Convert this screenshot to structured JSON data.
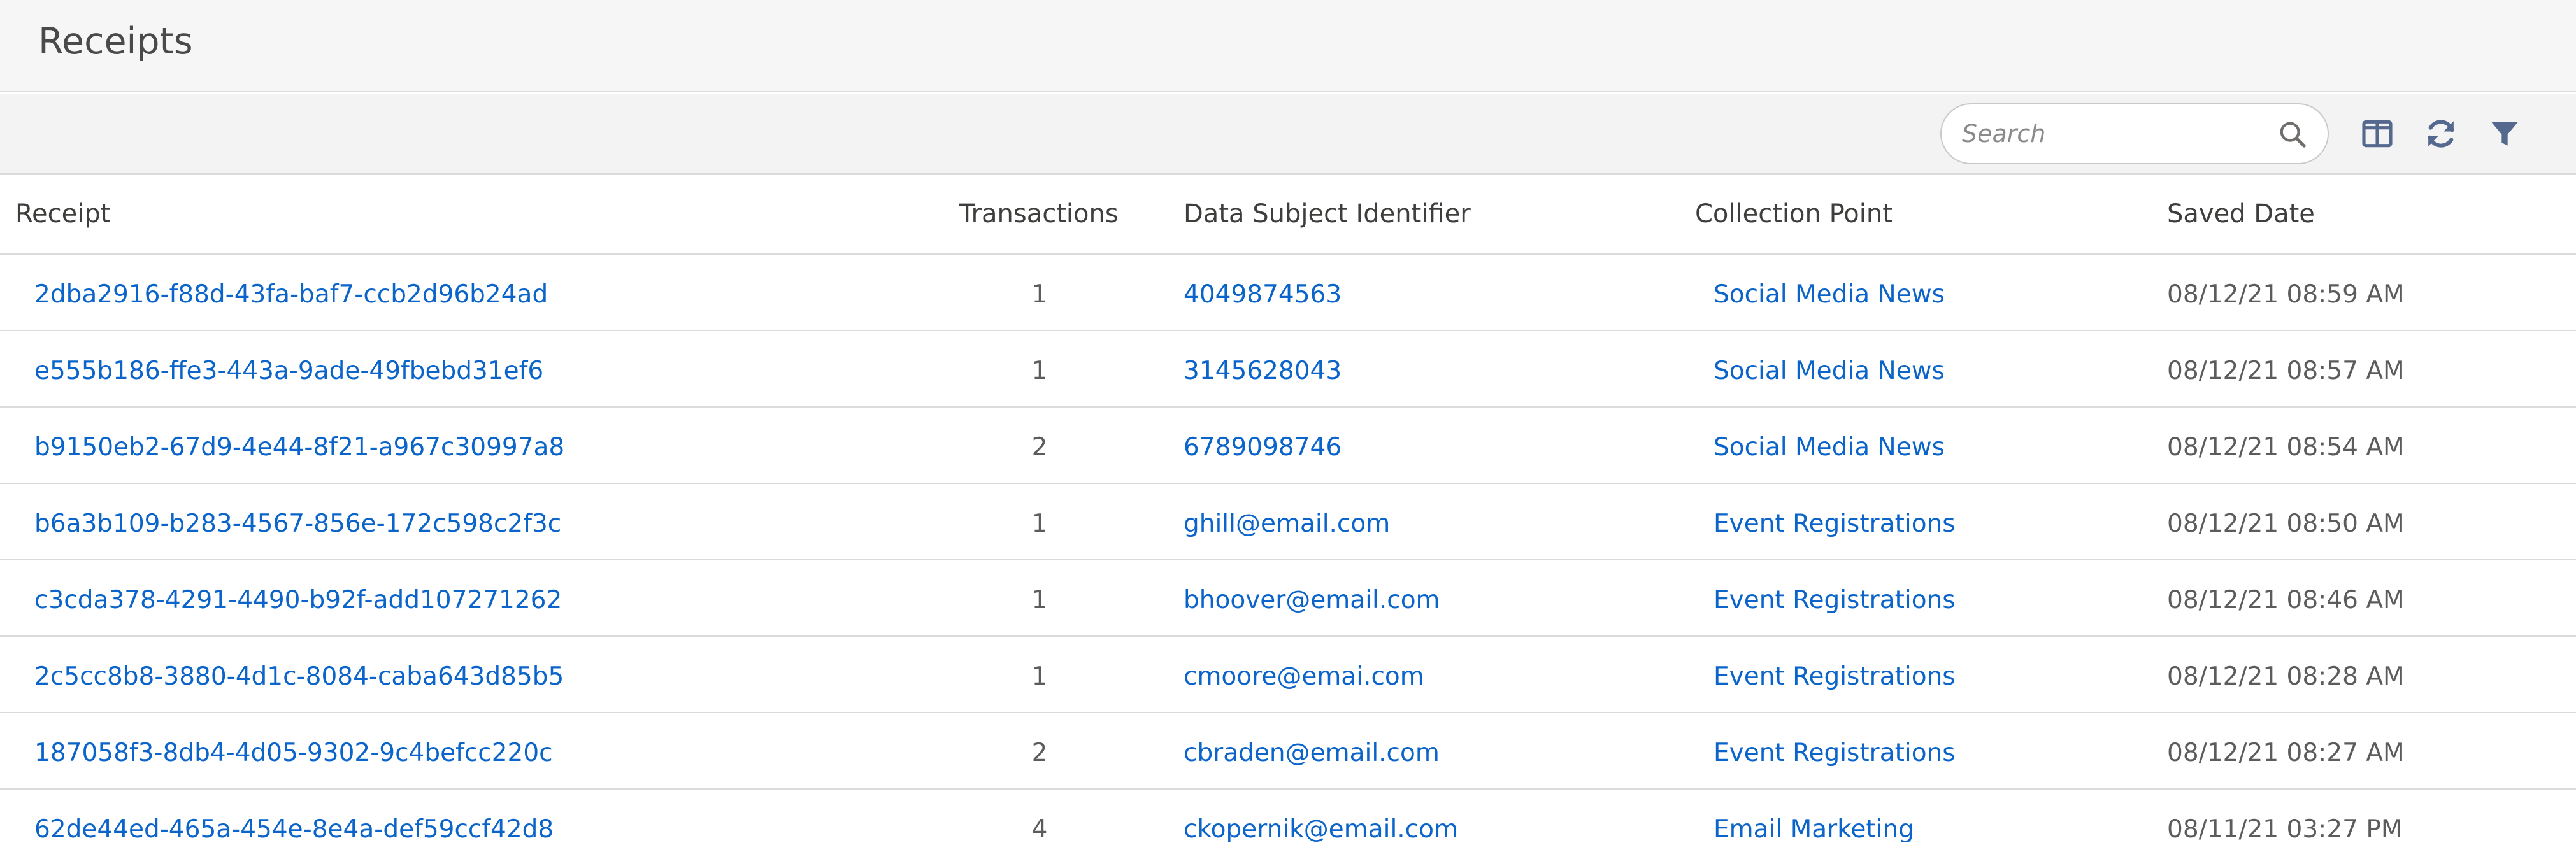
{
  "page": {
    "title": "Receipts"
  },
  "toolbar": {
    "search_placeholder": "Search",
    "search_value": "",
    "icons": [
      "search-icon",
      "columns-icon",
      "refresh-icon",
      "filter-icon"
    ]
  },
  "table": {
    "columns": [
      "Receipt",
      "Transactions",
      "Data Subject Identifier",
      "Collection Point",
      "Saved Date"
    ],
    "rows": [
      {
        "receipt": "2dba2916-f88d-43fa-baf7-ccb2d96b24ad",
        "transactions": "1",
        "identifier": "4049874563",
        "collection_point": "Social Media News",
        "saved_date": "08/12/21 08:59 AM"
      },
      {
        "receipt": "e555b186-ffe3-443a-9ade-49fbebd31ef6",
        "transactions": "1",
        "identifier": "3145628043",
        "collection_point": "Social Media News",
        "saved_date": "08/12/21 08:57 AM"
      },
      {
        "receipt": "b9150eb2-67d9-4e44-8f21-a967c30997a8",
        "transactions": "2",
        "identifier": "6789098746",
        "collection_point": "Social Media News",
        "saved_date": "08/12/21 08:54 AM"
      },
      {
        "receipt": "b6a3b109-b283-4567-856e-172c598c2f3c",
        "transactions": "1",
        "identifier": "ghill@email.com",
        "collection_point": "Event Registrations",
        "saved_date": "08/12/21 08:50 AM"
      },
      {
        "receipt": "c3cda378-4291-4490-b92f-add107271262",
        "transactions": "1",
        "identifier": "bhoover@email.com",
        "collection_point": "Event Registrations",
        "saved_date": "08/12/21 08:46 AM"
      },
      {
        "receipt": "2c5cc8b8-3880-4d1c-8084-caba643d85b5",
        "transactions": "1",
        "identifier": "cmoore@emai.com",
        "collection_point": "Event Registrations",
        "saved_date": "08/12/21 08:28 AM"
      },
      {
        "receipt": "187058f3-8db4-4d05-9302-9c4befcc220c",
        "transactions": "2",
        "identifier": "cbraden@email.com",
        "collection_point": "Event Registrations",
        "saved_date": "08/12/21 08:27 AM"
      },
      {
        "receipt": "62de44ed-465a-454e-8e4a-def59ccf42d8",
        "transactions": "4",
        "identifier": "ckopernik@email.com",
        "collection_point": "Email Marketing",
        "saved_date": "08/11/21 03:27 PM"
      }
    ]
  },
  "colors": {
    "link": "#0b64c9",
    "text": "#3e3e3c",
    "border": "#dddbda",
    "header_bg": "#f6f6f6",
    "toolbar_bg": "#f3f3f3"
  }
}
